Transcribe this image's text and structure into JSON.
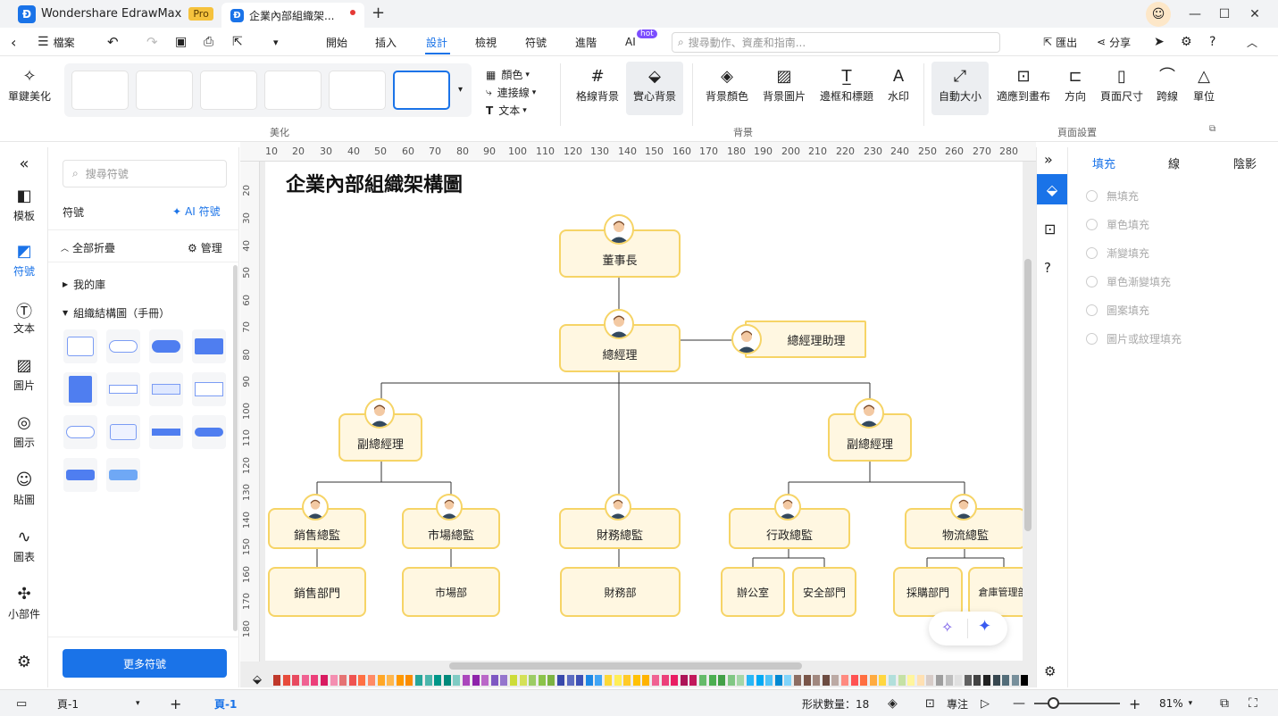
{
  "app": {
    "name": "Wondershare EdrawMax",
    "badge": "Pro",
    "doc_tab": "企業內部組織架..."
  },
  "menu": {
    "file": "檔案",
    "tabs": [
      "開始",
      "插入",
      "設計",
      "檢視",
      "符號",
      "進階",
      "AI"
    ],
    "ai_badge": "hot",
    "search_placeholder": "搜尋動作、資產和指南...",
    "export": "匯出",
    "share": "分享"
  },
  "ribbon": {
    "beautify_one_click": "單鍵美化",
    "group_beautify": "美化",
    "color": "顏色",
    "connector": "連接線",
    "text": "文本",
    "grid_bg": "格線背景",
    "solid_bg": "實心背景",
    "bg_color": "背景顏色",
    "bg_image": "背景圖片",
    "border_title": "邊框和標題",
    "watermark": "水印",
    "group_background": "背景",
    "auto_size": "自動大小",
    "fit_canvas": "適應到畫布",
    "orientation": "方向",
    "page_size": "頁面尺寸",
    "jump_line": "跨線",
    "unit": "單位",
    "group_page_setup": "頁面設置"
  },
  "rail": [
    "模板",
    "符號",
    "文本",
    "圖片",
    "圖示",
    "貼圖",
    "圖表",
    "小部件"
  ],
  "library": {
    "search_placeholder": "搜尋符號",
    "title": "符號",
    "ai_symbol": "AI 符號",
    "collapse_all": "全部折疊",
    "manage": "管理",
    "my_library": "我的庫",
    "category": "組織結構圖（手冊）",
    "more_button": "更多符號"
  },
  "ruler": {
    "top": [
      "10",
      "20",
      "30",
      "40",
      "50",
      "60",
      "70",
      "80",
      "90",
      "100",
      "110",
      "120",
      "130",
      "140",
      "150",
      "160",
      "170",
      "180",
      "190",
      "200",
      "210",
      "220",
      "230",
      "240",
      "250",
      "260",
      "270",
      "280"
    ],
    "left": [
      "20",
      "30",
      "40",
      "50",
      "60",
      "70",
      "80",
      "90",
      "100",
      "110",
      "120",
      "130",
      "140",
      "150",
      "160",
      "170",
      "180"
    ]
  },
  "diagram": {
    "title": "企業內部組織架構圖",
    "chairman": "董事長",
    "gm": "總經理",
    "gm_assistant": "總經理助理",
    "vp_left": "副總經理",
    "vp_right": "副總經理",
    "sales_dir": "銷售總監",
    "market_dir": "市場總監",
    "finance_dir": "財務總監",
    "admin_dir": "行政總監",
    "logistics_dir": "物流總監",
    "sales_dept": "銷售部門",
    "market_dept": "市場部",
    "finance_dept": "財務部",
    "office": "辦公室",
    "security_dept": "安全部門",
    "purchase_dept": "採購部門",
    "warehouse_dept": "倉庫管理部"
  },
  "right_panel": {
    "tabs": [
      "填充",
      "線",
      "陰影"
    ],
    "fill_options": [
      "無填充",
      "單色填充",
      "漸變填充",
      "單色漸變填充",
      "圖案填充",
      "圖片或紋理填充"
    ]
  },
  "status": {
    "page_label": "頁-1",
    "active_page": "頁-1",
    "shape_count": "形狀數量：18",
    "focus": "專注",
    "zoom": "81%"
  },
  "colors": {
    "accent": "#1a73e8",
    "node_fill": "#fff7e1",
    "node_border": "#f6d466"
  },
  "palette": [
    "#c0392b",
    "#e74c3c",
    "#e84a5f",
    "#f06292",
    "#ec407a",
    "#d81b60",
    "#f48fb1",
    "#e57373",
    "#ef5350",
    "#ff7043",
    "#ff8a65",
    "#ffa726",
    "#ffb74d",
    "#ff9800",
    "#fb8c00",
    "#26a69a",
    "#4db6ac",
    "#009688",
    "#00897b",
    "#80cbc4",
    "#ab47bc",
    "#8e24aa",
    "#ba68c8",
    "#7e57c2",
    "#9575cd",
    "#cddc39",
    "#d4e157",
    "#9ccc65",
    "#8bc34a",
    "#7cb342",
    "#3949ab",
    "#5c6bc0",
    "#3f51b5",
    "#1e88e5",
    "#42a5f5",
    "#fdd835",
    "#ffee58",
    "#ffca28",
    "#ffc107",
    "#ffb300",
    "#f06292",
    "#ec407a",
    "#e91e63",
    "#ad1457",
    "#c2185b",
    "#66bb6a",
    "#4caf50",
    "#43a047",
    "#81c784",
    "#a5d6a7",
    "#29b6f6",
    "#03a9f4",
    "#4fc3f7",
    "#0288d1",
    "#81d4fa",
    "#8d6e63",
    "#795548",
    "#a1887f",
    "#6d4c41",
    "#bcaaa4",
    "#ff8a80",
    "#ff5252",
    "#ff6e40",
    "#ffab40",
    "#ffd740",
    "#b2dfdb",
    "#c5e1a5",
    "#fff59d",
    "#ffe0b2",
    "#d7ccc8",
    "#9e9e9e",
    "#bdbdbd",
    "#e0e0e0",
    "#616161",
    "#424242",
    "#212121",
    "#37474f",
    "#546e7a",
    "#78909c",
    "#000000"
  ]
}
